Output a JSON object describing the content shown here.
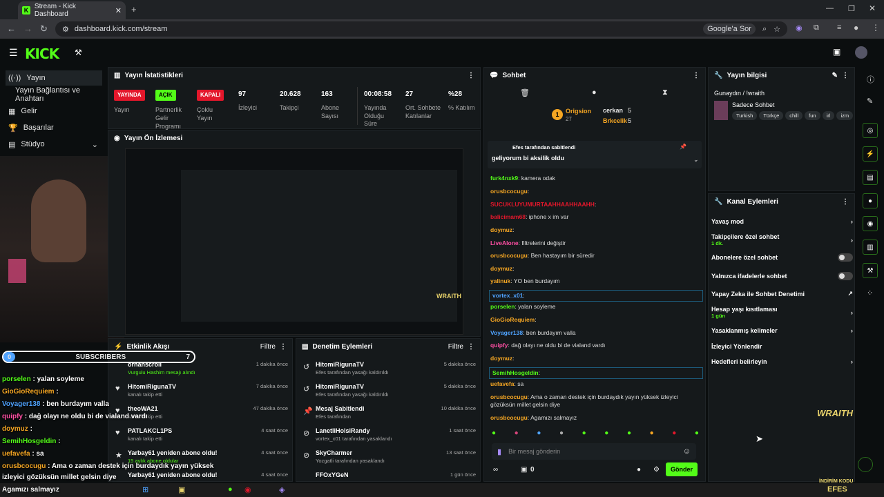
{
  "browser": {
    "tab_title": "Stream - Kick Dashboard",
    "url": "dashboard.kick.com/stream",
    "search_label": "Google'a Sor"
  },
  "sidebar": {
    "items": [
      {
        "label": "Yayın"
      },
      {
        "label": "Yayın Bağlantısı ve Anahtarı"
      },
      {
        "label": "Gelir"
      },
      {
        "label": "Başarılar"
      },
      {
        "label": "Stüdyo"
      }
    ]
  },
  "stats": {
    "title": "Yayın İstatistikleri",
    "yayin_badge": "YAYINDA",
    "yayin_label": "Yayın",
    "partner_badge": "AÇIK",
    "partner_label": "Partnerlik Gelir Programı",
    "cokluyayin_badge": "KAPALI",
    "cokluyayin_label": "Çoklu Yayın",
    "items": [
      {
        "value": "97",
        "label": "İzleyici"
      },
      {
        "value": "20.628",
        "label": "Takipçi"
      },
      {
        "value": "163",
        "label": "Abone Sayısı"
      },
      {
        "value": "00:08:58",
        "label": "Yayında Olduğu Süre"
      },
      {
        "value": "27",
        "label": "Ort. Sohbete Katılanlar"
      },
      {
        "value": "%28",
        "label": "% Katılım"
      }
    ]
  },
  "preview": {
    "title": "Yayın Ön İzlemesi",
    "watermark": "WRAITH"
  },
  "feed": {
    "title": "Etkinlik Akışı",
    "filter": "Filtre",
    "rows": [
      {
        "user": "orhanscroll",
        "sub": "Vurgulu Hashim mesajı alındı",
        "time": "1 dakika önce"
      },
      {
        "user": "HitomiRigunaTV",
        "sub": "kanalı takip etti",
        "time": "7 dakika önce"
      },
      {
        "user": "theoWA21",
        "sub": "kanalı takip etti",
        "time": "47 dakika önce"
      },
      {
        "user": "PATLAKCL1PS",
        "sub": "kanalı takip etti",
        "time": "4 saat önce"
      },
      {
        "user": "Yarbay61 yeniden abone oldu!",
        "sub": "15 aylık abone oldular",
        "time": "4 saat önce"
      },
      {
        "user": "Yarbay61 yeniden abone oldu!",
        "sub": "",
        "time": "4 saat önce"
      }
    ]
  },
  "mod": {
    "title": "Denetim Eylemleri",
    "filter": "Filtre",
    "rows": [
      {
        "user": "HitomiRigunaTV",
        "sub": "Efes tarafından yasağı kaldırıldı",
        "time": "5 dakika önce"
      },
      {
        "user": "HitomiRigunaTV",
        "sub": "Efes tarafından yasağı kaldırıldı",
        "time": "5 dakika önce"
      },
      {
        "user": "Mesaj Sabitlendi",
        "sub": "Efes tarafından",
        "time": "10 dakika önce"
      },
      {
        "user": "LanetliHolsiRandy",
        "sub": "vortex_x01 tarafından yasaklandı",
        "time": "1 saat önce"
      },
      {
        "user": "SkyCharmer",
        "sub": "Yozgatli tarafından yasaklandı",
        "time": "13 saat önce"
      },
      {
        "user": "FFOxYGeN",
        "sub": "",
        "time": "1 gün önce"
      }
    ]
  },
  "chat": {
    "title": "Sohbet",
    "top1": {
      "name": "Origsion",
      "count": "27"
    },
    "top2": {
      "name": "cerkan",
      "count": "5"
    },
    "top3": {
      "name": "Brkcelik",
      "count": "5"
    },
    "pinned_by": "Efes tarafından sabitlendi",
    "pinned_msg": "geliyorum bi aksilik oldu",
    "messages": [
      {
        "user": "furk4nxk9",
        "text": "kamera odak",
        "color": "#53fc18"
      },
      {
        "user": "orusbcocugu",
        "text": "",
        "color": "#f5a623"
      },
      {
        "user": "SUCUKLUYUMURTAAHHAAHHAAHH",
        "text": "",
        "color": "#e3172b"
      },
      {
        "user": "balicimam68",
        "text": "iphone x im var",
        "color": "#e3172b"
      },
      {
        "user": "doymuz",
        "text": "",
        "color": "#f5a623"
      },
      {
        "user": "LiveAlone",
        "text": "filtrelerini değiştir",
        "color": "#ff4fa3"
      },
      {
        "user": "orusbcocugu",
        "text": "Ben hastayım bir süredir",
        "color": "#f5a623"
      },
      {
        "user": "doymuz",
        "text": "",
        "color": "#f5a623"
      },
      {
        "user": "yalinuk",
        "text": "YO ben burdayım",
        "color": "#f5a623"
      },
      {
        "user": "vortex_x01",
        "text": "",
        "color": "#4fa3ff"
      },
      {
        "user": "porselen",
        "text": "yalan soyleme",
        "color": "#53fc18"
      },
      {
        "user": "GioGioRequiem",
        "text": "",
        "color": "#f5a623"
      },
      {
        "user": "Voyager138",
        "text": "ben burdayım valla",
        "color": "#4fa3ff"
      },
      {
        "user": "quipfy",
        "text": "dağ olayı ne oldu bi de vialand vardı",
        "color": "#ff4fa3"
      },
      {
        "user": "doymuz",
        "text": "",
        "color": "#f5a623"
      },
      {
        "user": "SemihHosgeldin",
        "text": "",
        "color": "#53fc18"
      },
      {
        "user": "uefavefa",
        "text": "sa",
        "color": "#f5a623"
      },
      {
        "user": "orusbcocugu",
        "text": "Ama o zaman destek için burdaydık yayın yüksek izleyici gözüksün millet gelsin diye",
        "color": "#f5a623"
      },
      {
        "user": "orusbcocugu",
        "text": "Agamızı salmayız",
        "color": "#f5a623"
      }
    ],
    "input_placeholder": "Bir mesaj gönderin",
    "count": "0",
    "send": "Gönder"
  },
  "info": {
    "title": "Yayın bilgisi",
    "stream_title": "Gunaydın / !wraith",
    "category": "Sadece Sohbet",
    "tags": [
      "Turkish",
      "Türkçe",
      "chill",
      "fun",
      "irl",
      "izm"
    ]
  },
  "actions": {
    "title": "Kanal Eylemleri",
    "items": [
      {
        "label": "Yavaş mod",
        "sub": ""
      },
      {
        "label": "Takipçilere özel sohbet",
        "sub": "1 dk."
      },
      {
        "label": "Abonelere özel sohbet",
        "sub": ""
      },
      {
        "label": "Yalnızca ifadelerle sohbet",
        "sub": ""
      },
      {
        "label": "Yapay Zeka ile Sohbet Denetimi",
        "sub": ""
      },
      {
        "label": "Hesap yaşı kısıtlaması",
        "sub": "1 gün"
      },
      {
        "label": "Yasaklanmış kelimeler",
        "sub": ""
      },
      {
        "label": "İzleyici Yönlendir",
        "sub": ""
      },
      {
        "label": "Hedefleri belirleyin",
        "sub": ""
      }
    ]
  },
  "overlay": {
    "sub_left": "0",
    "sub_title": "SUBSCRIBERS",
    "sub_right": "7",
    "lines": [
      {
        "user": "porselen",
        "text": ": yalan soyleme",
        "color": "#53fc18"
      },
      {
        "user": "GioGioRequiem",
        "text": ":",
        "color": "#f5a623"
      },
      {
        "user": "Voyager138",
        "text": ": ben burdayım valla",
        "color": "#4fa3ff"
      },
      {
        "user": "quipfy",
        "text": ": dağ olayı ne oldu bi de vialand vardı",
        "color": "#ff4fa3"
      },
      {
        "user": "doymuz",
        "text": ":",
        "color": "#f5a623"
      },
      {
        "user": "SemihHosgeldin",
        "text": ":",
        "color": "#53fc18"
      },
      {
        "user": "uefavefa",
        "text": ": sa",
        "color": "#f5a623"
      },
      {
        "user": "orusbcocugu",
        "text": ": Ama o zaman destek için burdaydık yayın yüksek",
        "color": "#f5a623"
      },
      {
        "user": "",
        "text": "izleyici gözüksün millet gelsin diye",
        "color": "#fff"
      },
      {
        "user": "",
        "text": "Agamızı salmayız",
        "color": "#fff"
      }
    ],
    "brand": "WRAITH",
    "promo1": "İNDİRİM KODU",
    "promo2": "EFES"
  },
  "colors": {
    "accent": "#53fc18",
    "danger": "#e3172b",
    "bg": "#0b0e0f",
    "panel": "#15191b"
  }
}
